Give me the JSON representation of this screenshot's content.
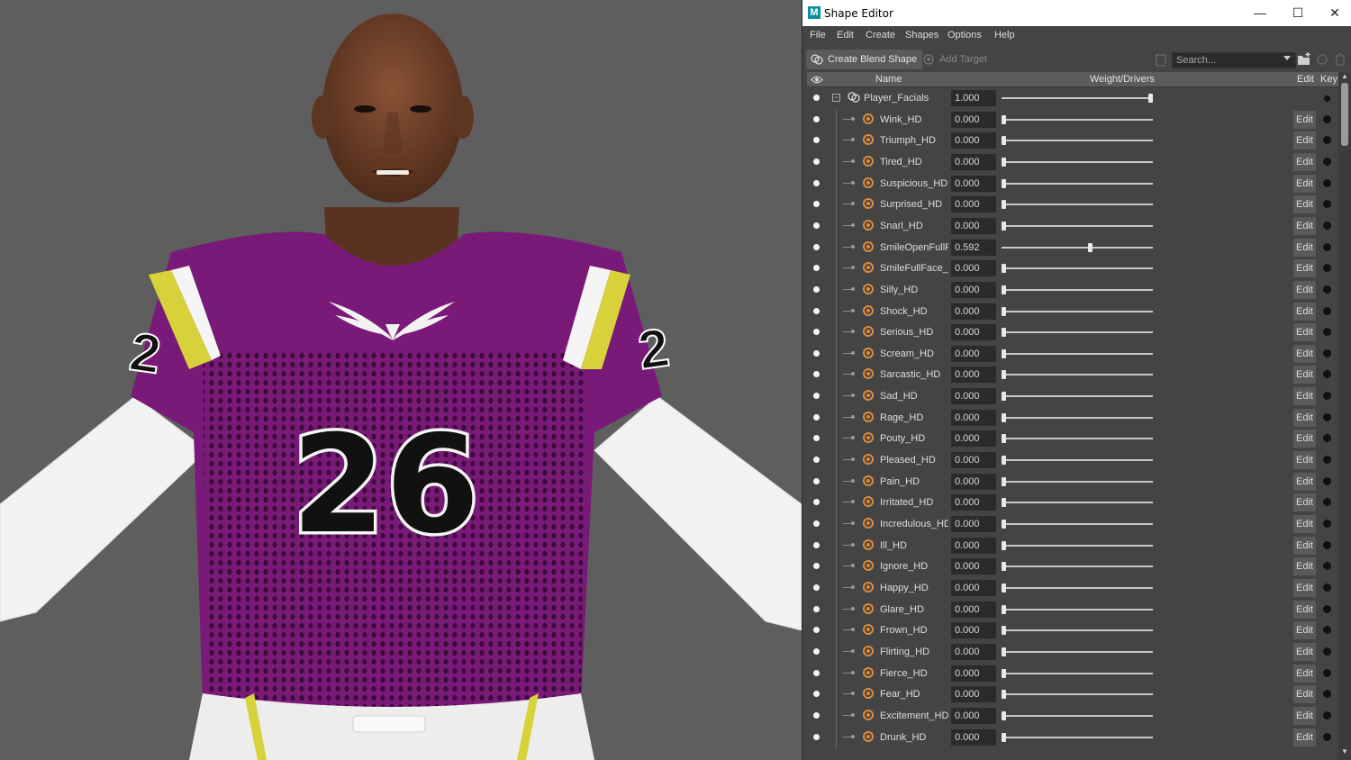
{
  "window": {
    "title": "Shape Editor",
    "logo_letter": "M",
    "minimize_glyph": "—",
    "maximize_glyph": "☐",
    "close_glyph": "✕"
  },
  "menu": [
    "File",
    "Edit",
    "Create",
    "Shapes",
    "Options",
    "Help"
  ],
  "toolbar": {
    "create_blend_shape": "Create Blend Shape",
    "add_target": "Add Target",
    "search_placeholder": "Search..."
  },
  "columns": {
    "name": "Name",
    "weight": "Weight/Drivers",
    "edit": "Edit",
    "key": "Key"
  },
  "blend_shape": {
    "name": "Player_Facials",
    "value": "1.000",
    "weight": 1.0
  },
  "targets": [
    {
      "name": "Wink_HD",
      "value": "0.000",
      "weight": 0
    },
    {
      "name": "Triumph_HD",
      "value": "0.000",
      "weight": 0
    },
    {
      "name": "Tired_HD",
      "value": "0.000",
      "weight": 0
    },
    {
      "name": "Suspicious_HD",
      "value": "0.000",
      "weight": 0
    },
    {
      "name": "Surprised_HD",
      "value": "0.000",
      "weight": 0
    },
    {
      "name": "Snarl_HD",
      "value": "0.000",
      "weight": 0
    },
    {
      "name": "SmileOpenFullFace_HD",
      "value": "0.592",
      "weight": 0.592
    },
    {
      "name": "SmileFullFace_HD",
      "value": "0.000",
      "weight": 0
    },
    {
      "name": "Silly_HD",
      "value": "0.000",
      "weight": 0
    },
    {
      "name": "Shock_HD",
      "value": "0.000",
      "weight": 0
    },
    {
      "name": "Serious_HD",
      "value": "0.000",
      "weight": 0
    },
    {
      "name": "Scream_HD",
      "value": "0.000",
      "weight": 0
    },
    {
      "name": "Sarcastic_HD",
      "value": "0.000",
      "weight": 0
    },
    {
      "name": "Sad_HD",
      "value": "0.000",
      "weight": 0
    },
    {
      "name": "Rage_HD",
      "value": "0.000",
      "weight": 0
    },
    {
      "name": "Pouty_HD",
      "value": "0.000",
      "weight": 0
    },
    {
      "name": "Pleased_HD",
      "value": "0.000",
      "weight": 0
    },
    {
      "name": "Pain_HD",
      "value": "0.000",
      "weight": 0
    },
    {
      "name": "Irritated_HD",
      "value": "0.000",
      "weight": 0
    },
    {
      "name": "Incredulous_HD",
      "value": "0.000",
      "weight": 0
    },
    {
      "name": "Ill_HD",
      "value": "0.000",
      "weight": 0
    },
    {
      "name": "Ignore_HD",
      "value": "0.000",
      "weight": 0
    },
    {
      "name": "Happy_HD",
      "value": "0.000",
      "weight": 0
    },
    {
      "name": "Glare_HD",
      "value": "0.000",
      "weight": 0
    },
    {
      "name": "Frown_HD",
      "value": "0.000",
      "weight": 0
    },
    {
      "name": "Flirting_HD",
      "value": "0.000",
      "weight": 0
    },
    {
      "name": "Fierce_HD",
      "value": "0.000",
      "weight": 0
    },
    {
      "name": "Fear_HD",
      "value": "0.000",
      "weight": 0
    },
    {
      "name": "Excitement_HD",
      "value": "0.000",
      "weight": 0
    },
    {
      "name": "Drunk_HD",
      "value": "0.000",
      "weight": 0
    }
  ],
  "viewport": {
    "jersey_number": "26",
    "jersey_color": "#7a1a78",
    "stripe_color": "#d8d23a",
    "skin_color": "#6b3e26"
  }
}
